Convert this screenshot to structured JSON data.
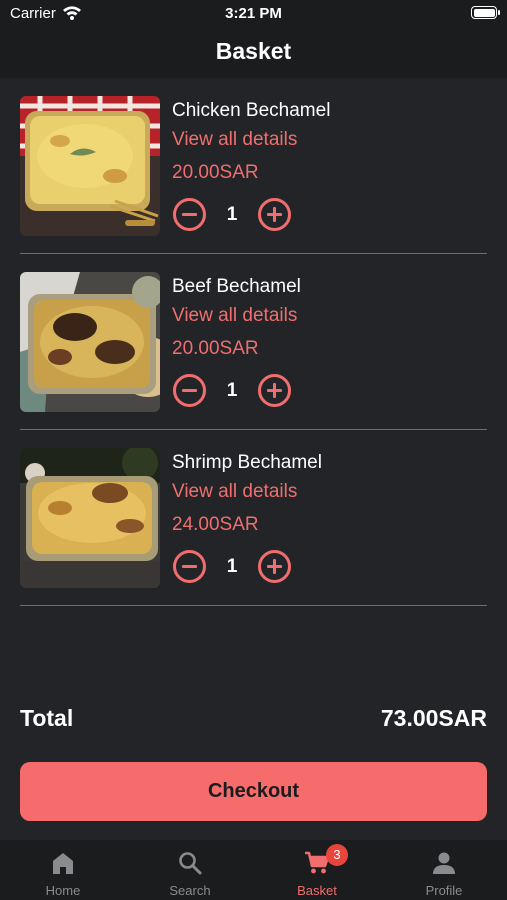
{
  "status_bar": {
    "carrier": "Carrier",
    "time": "3:21 PM"
  },
  "header": {
    "title": "Basket"
  },
  "basket": {
    "items": [
      {
        "name": "Chicken Bechamel",
        "details_link": "View all details",
        "price": "20.00SAR",
        "quantity": "1"
      },
      {
        "name": "Beef Bechamel",
        "details_link": "View all details",
        "price": "20.00SAR",
        "quantity": "1"
      },
      {
        "name": "Shrimp Bechamel",
        "details_link": "View all details",
        "price": "24.00SAR",
        "quantity": "1"
      }
    ]
  },
  "summary": {
    "total_label": "Total",
    "total_value": "73.00SAR"
  },
  "checkout": {
    "label": "Checkout"
  },
  "tab_bar": {
    "tabs": [
      {
        "label": "Home",
        "icon": "home-icon",
        "active": false
      },
      {
        "label": "Search",
        "icon": "search-icon",
        "active": false
      },
      {
        "label": "Basket",
        "icon": "cart-icon",
        "active": true,
        "badge": "3"
      },
      {
        "label": "Profile",
        "icon": "person-icon",
        "active": false
      }
    ]
  },
  "colors": {
    "background": "#232427",
    "bar_background": "#1b1c1e",
    "accent": "#f06e6e",
    "checkout_button": "#f66c6c",
    "badge": "#e8453c",
    "inactive_tab": "#8a8b8f"
  }
}
